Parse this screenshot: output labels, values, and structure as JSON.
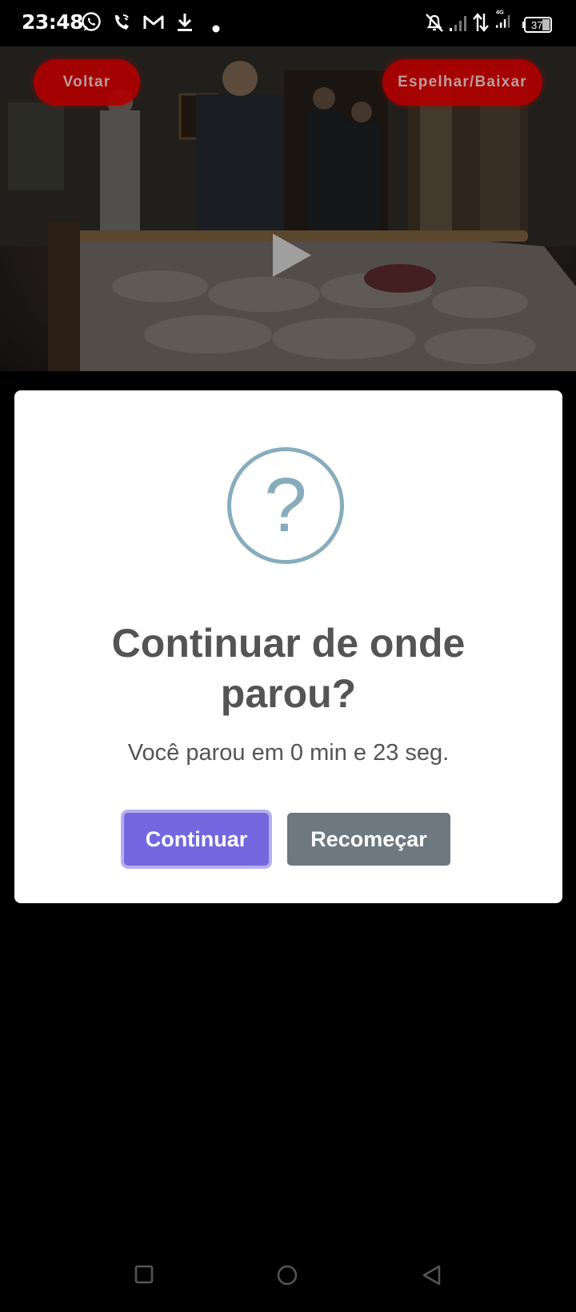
{
  "status_bar": {
    "time": "23:48",
    "icons_left": [
      "whatsapp-icon",
      "wifi-call-icon",
      "gmail-icon",
      "download-icon",
      "dot-icon"
    ],
    "icons_right": [
      "bell-off-icon",
      "signal-icon",
      "data-arrows-icon",
      "signal-4g-icon",
      "battery-icon"
    ],
    "network": "4G",
    "battery": "37"
  },
  "video": {
    "back_label": "Voltar",
    "mirror_label": "Espelhar/Baixar",
    "accent": "#b00000"
  },
  "dialog": {
    "title": "Continuar de onde parou?",
    "message": "Você parou em 0 min e 23 seg.",
    "continue_label": "Continuar",
    "restart_label": "Recomeçar",
    "icon": "question-icon",
    "icon_glyph": "?",
    "colors": {
      "icon": "#87adbd",
      "continue_bg": "#7367e0",
      "restart_bg": "#6e7881",
      "text": "#545454"
    }
  },
  "nav_bar": {
    "buttons": [
      "recents-icon",
      "home-icon",
      "back-icon"
    ]
  }
}
